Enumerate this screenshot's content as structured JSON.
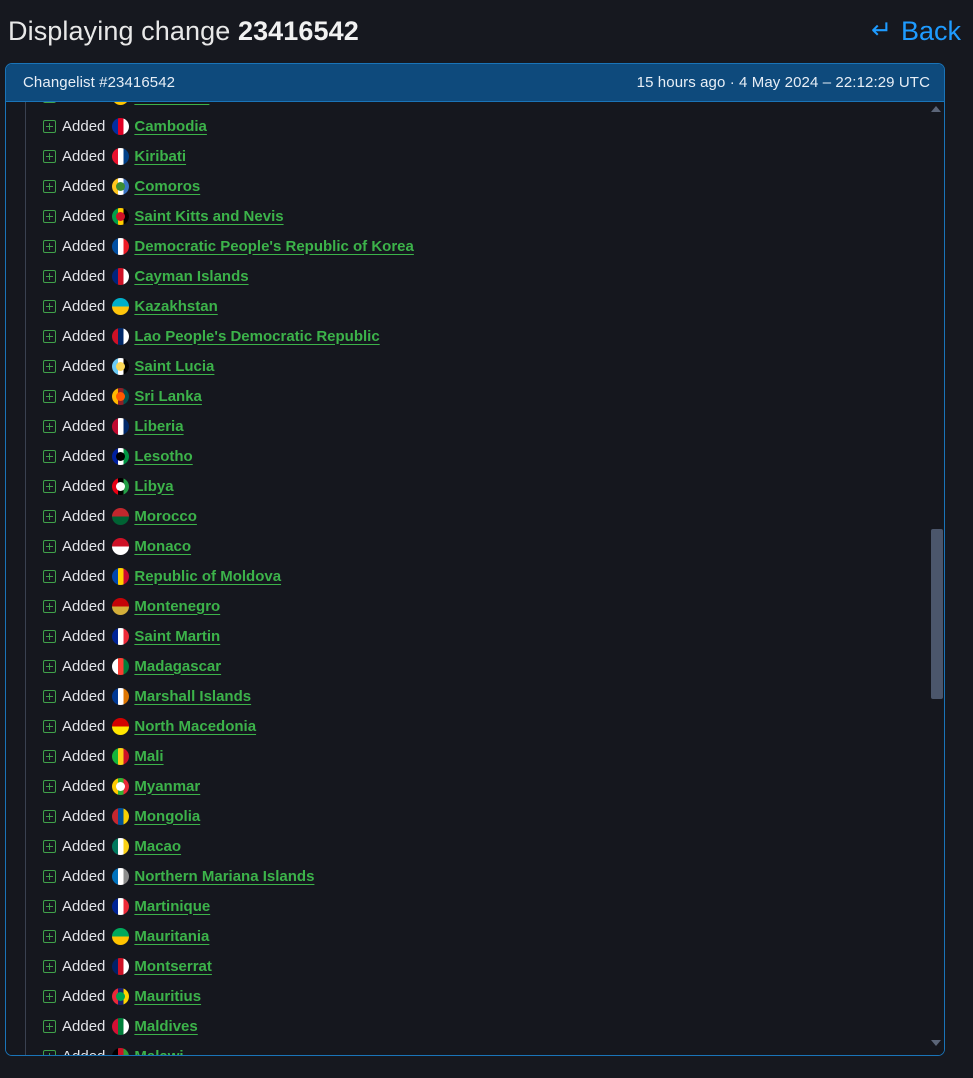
{
  "header": {
    "title_prefix": "Displaying change",
    "change_id": "23416542",
    "back_label": "Back",
    "back_icon": "return-arrow-icon",
    "back_color": "#1e9bff"
  },
  "changelist": {
    "id_label": "Changelist #23416542",
    "timestamp": "15 hours ago · 4 May 2024 – 22:12:29 UTC",
    "header_bg": "#0e4a7c",
    "border_color": "#1a74b8"
  },
  "tree": {
    "expander_icon": "plus-square-icon",
    "action_label": "Added",
    "link_color": "#3cb34a",
    "rows": [
      {
        "action": "Added",
        "country": "Mauritania",
        "flag": "🇲🇷",
        "clipped": true
      },
      {
        "action": "Added",
        "country": "Cambodia",
        "flag": "🇰🇭"
      },
      {
        "action": "Added",
        "country": "Kiribati",
        "flag": "🇰🇮"
      },
      {
        "action": "Added",
        "country": "Comoros",
        "flag": "🇰🇲"
      },
      {
        "action": "Added",
        "country": "Saint Kitts and Nevis",
        "flag": "🇰🇳"
      },
      {
        "action": "Added",
        "country": "Democratic People's Republic of Korea",
        "flag": "🇰🇵"
      },
      {
        "action": "Added",
        "country": "Cayman Islands",
        "flag": "🇰🇾"
      },
      {
        "action": "Added",
        "country": "Kazakhstan",
        "flag": "🇰🇿"
      },
      {
        "action": "Added",
        "country": "Lao People's Democratic Republic",
        "flag": "🇱🇦"
      },
      {
        "action": "Added",
        "country": "Saint Lucia",
        "flag": "🇱🇨"
      },
      {
        "action": "Added",
        "country": "Sri Lanka",
        "flag": "🇱🇰"
      },
      {
        "action": "Added",
        "country": "Liberia",
        "flag": "🇱🇷"
      },
      {
        "action": "Added",
        "country": "Lesotho",
        "flag": "🇱🇸"
      },
      {
        "action": "Added",
        "country": "Libya",
        "flag": "🇱🇾"
      },
      {
        "action": "Added",
        "country": "Morocco",
        "flag": "🇲🇦"
      },
      {
        "action": "Added",
        "country": "Monaco",
        "flag": "🇲🇨"
      },
      {
        "action": "Added",
        "country": "Republic of Moldova",
        "flag": "🇲🇩"
      },
      {
        "action": "Added",
        "country": "Montenegro",
        "flag": "🇲🇪"
      },
      {
        "action": "Added",
        "country": "Saint Martin",
        "flag": "🇲🇫"
      },
      {
        "action": "Added",
        "country": "Madagascar",
        "flag": "🇲🇬"
      },
      {
        "action": "Added",
        "country": "Marshall Islands",
        "flag": "🇲🇭"
      },
      {
        "action": "Added",
        "country": "North Macedonia",
        "flag": "🇲🇰"
      },
      {
        "action": "Added",
        "country": "Mali",
        "flag": "🇲🇱"
      },
      {
        "action": "Added",
        "country": "Myanmar",
        "flag": "🇲🇲"
      },
      {
        "action": "Added",
        "country": "Mongolia",
        "flag": "🇲🇳"
      },
      {
        "action": "Added",
        "country": "Macao",
        "flag": "🇲🇴"
      },
      {
        "action": "Added",
        "country": "Northern Mariana Islands",
        "flag": "🇲🇵"
      },
      {
        "action": "Added",
        "country": "Martinique",
        "flag": "🇲🇶"
      },
      {
        "action": "Added",
        "country": "Mauritania",
        "flag": "🇲🇷"
      },
      {
        "action": "Added",
        "country": "Montserrat",
        "flag": "🇲🇸"
      },
      {
        "action": "Added",
        "country": "Mauritius",
        "flag": "🇲🇺"
      },
      {
        "action": "Added",
        "country": "Maldives",
        "flag": "🇲🇻"
      },
      {
        "action": "Added",
        "country": "Malawi",
        "flag": "🇲🇼"
      }
    ]
  },
  "scrollbar": {
    "up_arrow_icon": "caret-up-icon",
    "down_arrow_icon": "caret-down-icon",
    "thumb_color": "#4b566b"
  },
  "flag_colors": {
    "Cambodia": [
      "#032ea1",
      "#e00025",
      "#ffffff"
    ],
    "Kiribati": [
      "#e8112d",
      "#ffffff",
      "#003f87"
    ],
    "Comoros": [
      "#ffc61e",
      "#ffffff",
      "#3a75c4",
      "#3d8e33"
    ],
    "Saint Kitts and Nevis": [
      "#009e49",
      "#ffcd00",
      "#000000",
      "#ce1126"
    ],
    "Democratic People's Republic of Korea": [
      "#024fa2",
      "#ffffff",
      "#ed1c27"
    ],
    "Cayman Islands": [
      "#00247d",
      "#ce1126",
      "#ffffff"
    ],
    "Kazakhstan": [
      "#00afca",
      "#fec50c"
    ],
    "Lao People's Democratic Republic": [
      "#ce1126",
      "#002868",
      "#ffffff"
    ],
    "Saint Lucia": [
      "#6cccf6",
      "#ffffff",
      "#000000",
      "#fcd856"
    ],
    "Sri Lanka": [
      "#ffb700",
      "#8d2029",
      "#00534e",
      "#ff5800"
    ],
    "Liberia": [
      "#bf0a30",
      "#ffffff",
      "#002868"
    ],
    "Lesotho": [
      "#00209f",
      "#ffffff",
      "#009543",
      "#000000"
    ],
    "Libya": [
      "#e70013",
      "#000000",
      "#239e46",
      "#ffffff"
    ],
    "Morocco": [
      "#c1272d",
      "#006233"
    ],
    "Monaco": [
      "#ce1126",
      "#ffffff"
    ],
    "Republic of Moldova": [
      "#0046ae",
      "#ffd200",
      "#cc092f"
    ],
    "Montenegro": [
      "#c40308",
      "#d4af3a"
    ],
    "Saint Martin": [
      "#002395",
      "#ffffff",
      "#ed2939"
    ],
    "Madagascar": [
      "#ffffff",
      "#fc3d32",
      "#007e3a"
    ],
    "Marshall Islands": [
      "#003893",
      "#ffffff",
      "#dd7500"
    ],
    "North Macedonia": [
      "#d20000",
      "#ffe600"
    ],
    "Mali": [
      "#14b53a",
      "#fcd116",
      "#ce1126"
    ],
    "Myanmar": [
      "#fecb00",
      "#34b233",
      "#ea2839",
      "#ffffff"
    ],
    "Mongolia": [
      "#c4272f",
      "#015197",
      "#f9cf02"
    ],
    "Macao": [
      "#00785e",
      "#ffffff",
      "#fbd116"
    ],
    "Northern Mariana Islands": [
      "#0071bc",
      "#ffffff",
      "#8c8c8c"
    ],
    "Martinique": [
      "#002395",
      "#ffffff",
      "#ed2939"
    ],
    "Mauritania": [
      "#00a95c",
      "#ffc400"
    ],
    "Montserrat": [
      "#012169",
      "#ce1126",
      "#ffffff"
    ],
    "Mauritius": [
      "#ea2839",
      "#1a206d",
      "#ffd500",
      "#00a551"
    ],
    "Maldives": [
      "#d21034",
      "#007e3a",
      "#ffffff"
    ],
    "Malawi": [
      "#000000",
      "#ce1126",
      "#339e35"
    ]
  }
}
